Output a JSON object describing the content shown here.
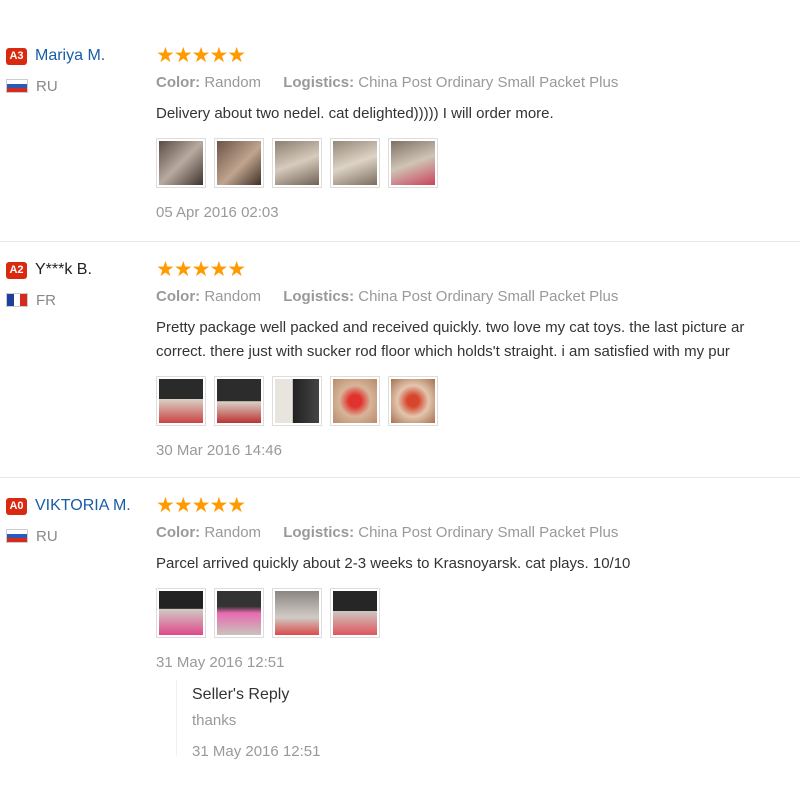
{
  "reviews": [
    {
      "level": "A3",
      "name": "Mariya M.",
      "country": "RU",
      "stars": "★★★★★",
      "color_label": "Color:",
      "color_value": "Random",
      "logistics_label": "Logistics:",
      "logistics_value": "China Post Ordinary Small Packet Plus",
      "text": "Delivery about two nedel. cat delighted))))) I will order more.",
      "date": "05 Apr 2016 02:03"
    },
    {
      "level": "A2",
      "name": "Y***k B.",
      "country": "FR",
      "stars": "★★★★★",
      "color_label": "Color:",
      "color_value": "Random",
      "logistics_label": "Logistics:",
      "logistics_value": "China Post Ordinary Small Packet Plus",
      "text_line1": "Pretty package well packed and received quickly. two love my cat toys. the last picture ar",
      "text_line2": "correct. there just with sucker rod floor which holds't straight. i am satisfied with my pur",
      "date": "30 Mar 2016 14:46"
    },
    {
      "level": "A0",
      "name": "VIKTORIA M.",
      "country": "RU",
      "stars": "★★★★★",
      "color_label": "Color:",
      "color_value": "Random",
      "logistics_label": "Logistics:",
      "logistics_value": "China Post Ordinary Small Packet Plus",
      "text": "Parcel arrived quickly about 2-3 weeks to Krasnoyarsk. cat plays. 10/10",
      "date": "31 May 2016 12:51",
      "reply": {
        "title": "Seller's Reply",
        "text": "thanks",
        "date": "31 May 2016 12:51"
      }
    }
  ],
  "colors": {
    "level_badge": "#d9290f",
    "name_link": "#1a5ca8",
    "star": "#ff9a00"
  }
}
